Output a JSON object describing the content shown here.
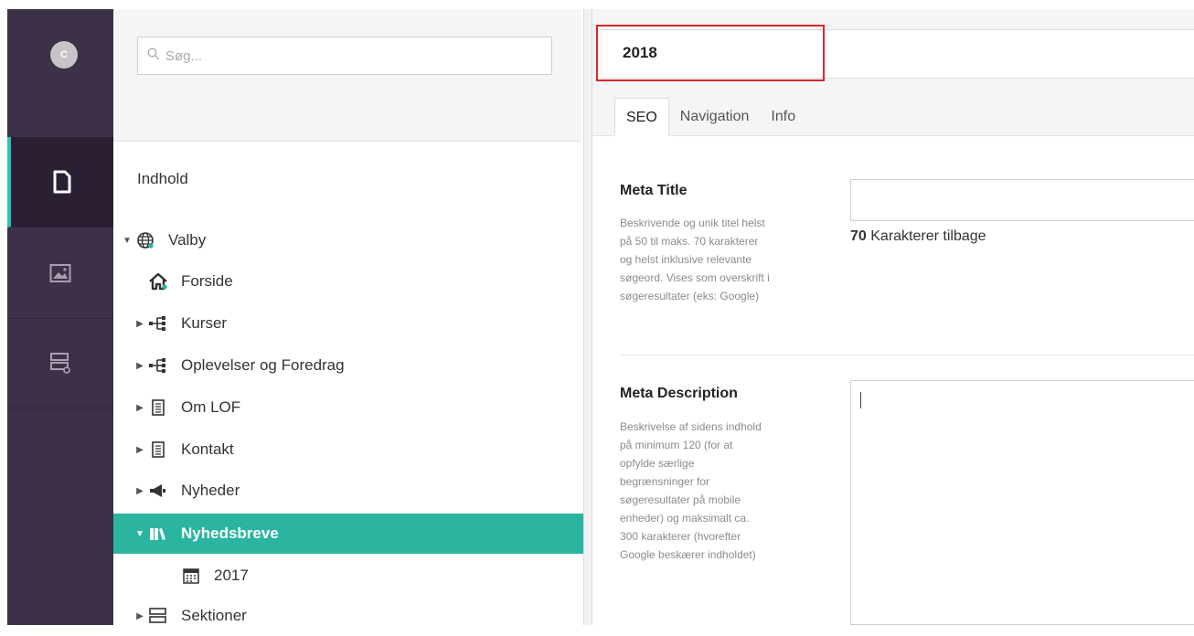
{
  "rail": {
    "avatar_initial": "C",
    "items": [
      {
        "name": "content-icon",
        "active": true
      },
      {
        "name": "media-icon",
        "active": false
      },
      {
        "name": "sections-icon",
        "active": false
      }
    ]
  },
  "search": {
    "placeholder": "Søg..."
  },
  "tree": {
    "title": "Indhold",
    "items": [
      {
        "label": "Valby",
        "icon": "globe-icon",
        "expanded": true
      },
      {
        "label": "Forside",
        "icon": "home-icon"
      },
      {
        "label": "Kurser",
        "icon": "sitemap-icon"
      },
      {
        "label": "Oplevelser og Foredrag",
        "icon": "sitemap-icon"
      },
      {
        "label": "Om LOF",
        "icon": "document-icon"
      },
      {
        "label": "Kontakt",
        "icon": "document-icon"
      },
      {
        "label": "Nyheder",
        "icon": "megaphone-icon"
      },
      {
        "label": "Nyhedsbreve",
        "icon": "books-icon",
        "selected": true
      },
      {
        "label": "2017",
        "icon": "calendar-icon"
      },
      {
        "label": "Sektioner",
        "icon": "sections-icon"
      }
    ]
  },
  "editor": {
    "name_value": "2018",
    "tabs": [
      {
        "label": "SEO",
        "active": true
      },
      {
        "label": "Navigation",
        "active": false
      },
      {
        "label": "Info",
        "active": false
      }
    ],
    "meta_title": {
      "label": "Meta Title",
      "desc_lines": [
        "Beskrivende og unik titel helst",
        "på 50 til maks. 70 karakterer",
        "og helst inklusive relevante",
        "søgeord. Vises som overskrift i",
        "søgeresultater (eks: Google)"
      ],
      "value": "",
      "counter_number": "70",
      "counter_text": "Karakterer tilbage"
    },
    "meta_description": {
      "label": "Meta Description",
      "desc_lines": [
        "Beskrivelse af sidens indhold",
        "på minimum 120 (for at",
        "opfylde særlige",
        "begrænsninger for",
        "søgeresultater på mobile",
        "enheder) og maksimalt ca.",
        "300 karakterer (hvorefter",
        "Google beskærer indholdet)"
      ],
      "value": ""
    }
  },
  "colors": {
    "rail": "#3d3147",
    "accent": "#2bb5a0",
    "highlight": "#d8282e"
  }
}
